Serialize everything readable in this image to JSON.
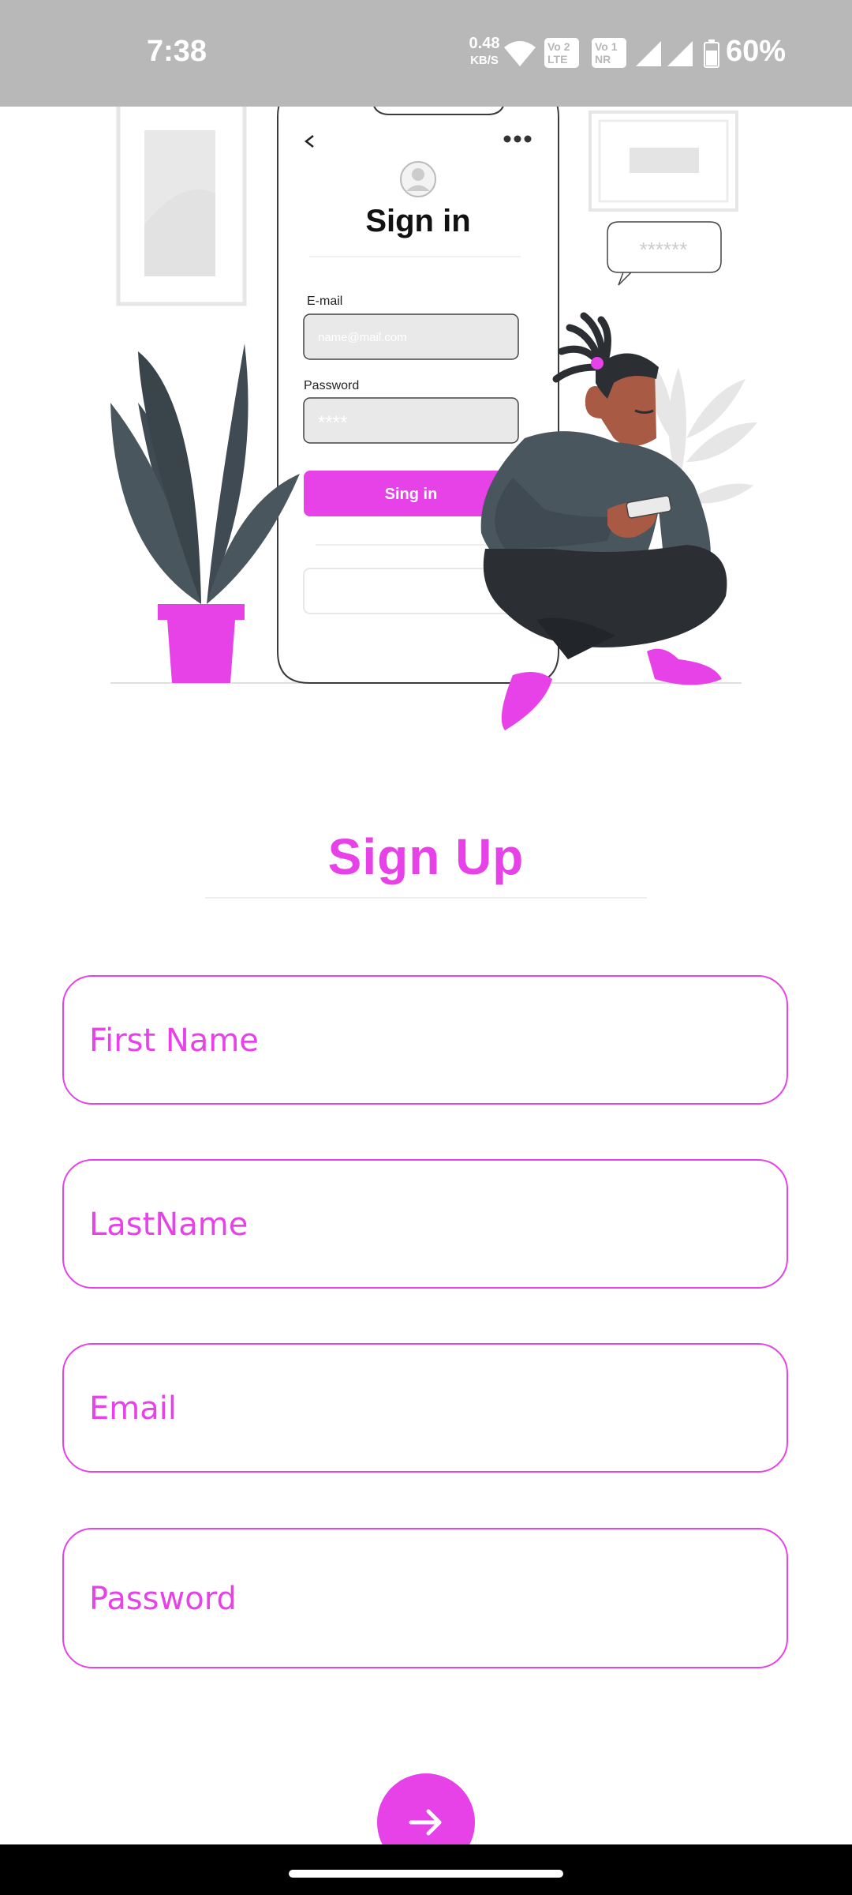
{
  "status_bar": {
    "time": "7:38",
    "net_speed": "0.48",
    "net_unit": "KB/S",
    "sim1_label": "Vo 2\nLTE",
    "sim2_label": "Vo 1\nNR",
    "battery": "60%"
  },
  "illustration": {
    "phone_title": "Sign in",
    "email_label": "E-mail",
    "email_placeholder": "name@mail.com",
    "password_label": "Password",
    "password_value": "****",
    "button_label": "Sing in",
    "bubble_text": "******"
  },
  "form": {
    "title": "Sign Up",
    "first_name_placeholder": "First Name",
    "last_name_placeholder": "LastName",
    "email_placeholder": "Email",
    "password_placeholder": "Password"
  },
  "colors": {
    "accent": "#e642e8",
    "status_bar": "#b8b8b8"
  },
  "icons": {
    "next": "arrow-right-icon"
  }
}
